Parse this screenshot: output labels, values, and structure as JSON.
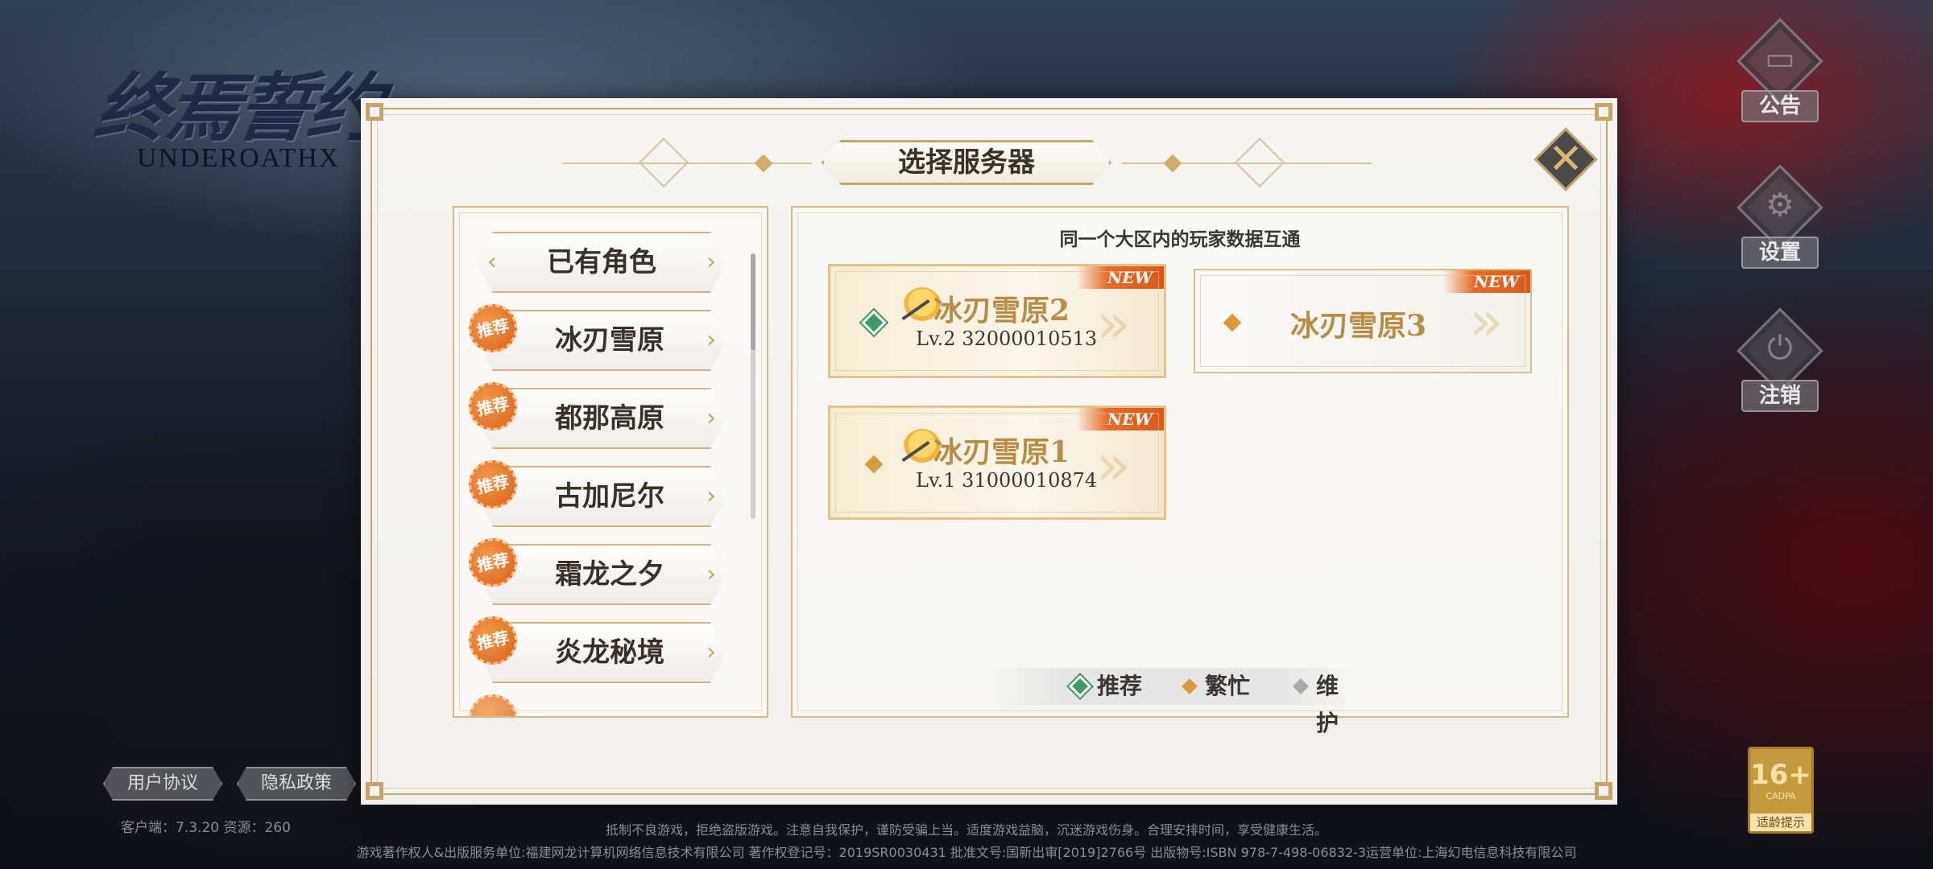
{
  "app": {
    "logo_cn": "终焉誓约",
    "logo_en": "UNDEROATHX"
  },
  "side_menu": [
    {
      "label": "公告",
      "icon": "announcement-icon"
    },
    {
      "label": "设置",
      "icon": "gear-icon"
    },
    {
      "label": "注销",
      "icon": "power-icon"
    }
  ],
  "links": {
    "user_agreement": "用户协议",
    "privacy_policy": "隐私政策"
  },
  "version_text": "客户端：7.3.20   资源：260",
  "footer": {
    "line1": "抵制不良游戏，拒绝盗版游戏。注意自我保护，谨防受骗上当。适度游戏益脑，沉迷游戏伤身。合理安排时间，享受健康生活。",
    "line2": "游戏著作权人&出版服务单位:福建网龙计算机网络信息技术有限公司  著作权登记号：2019SR0030431  批准文号:国新出审[2019]2766号  出版物号:ISBN 978-7-498-06832-3运营单位:上海幻电信息科技有限公司"
  },
  "age_rating": {
    "value": "16+",
    "org": "CADPA",
    "tip": "适龄提示"
  },
  "dialog": {
    "title": "选择服务器",
    "close_label": "✕",
    "hint": "同一个大区内的玩家数据互通",
    "regions": [
      {
        "label": "已有角色",
        "recommended": false
      },
      {
        "label": "冰刃雪原",
        "recommended": true,
        "badge": "推荐"
      },
      {
        "label": "都那高原",
        "recommended": true,
        "badge": "推荐"
      },
      {
        "label": "古加尼尔",
        "recommended": true,
        "badge": "推荐"
      },
      {
        "label": "霜龙之夕",
        "recommended": true,
        "badge": "推荐"
      },
      {
        "label": "炎龙秘境",
        "recommended": true,
        "badge": "推荐"
      }
    ],
    "servers": [
      {
        "name": "冰刃雪原2",
        "level": "Lv.2 32000010513",
        "tag": "NEW",
        "status": "recommended",
        "has_character": true
      },
      {
        "name": "冰刃雪原3",
        "level": "",
        "tag": "NEW",
        "status": "busy",
        "has_character": false
      },
      {
        "name": "冰刃雪原1",
        "level": "Lv.1 31000010874",
        "tag": "NEW",
        "status": "busy",
        "has_character": true
      }
    ],
    "legend": [
      {
        "label": "推荐",
        "color": "#3f9a63"
      },
      {
        "label": "繁忙",
        "color": "#d99a3c"
      },
      {
        "label": "维护",
        "color": "#a8a8a8"
      }
    ]
  },
  "colors": {
    "gold": "#c6a46a",
    "recommended": "#3f9a63",
    "busy": "#d99a3c",
    "maintenance": "#a8a8a8",
    "badge_orange": "#e0702a"
  }
}
